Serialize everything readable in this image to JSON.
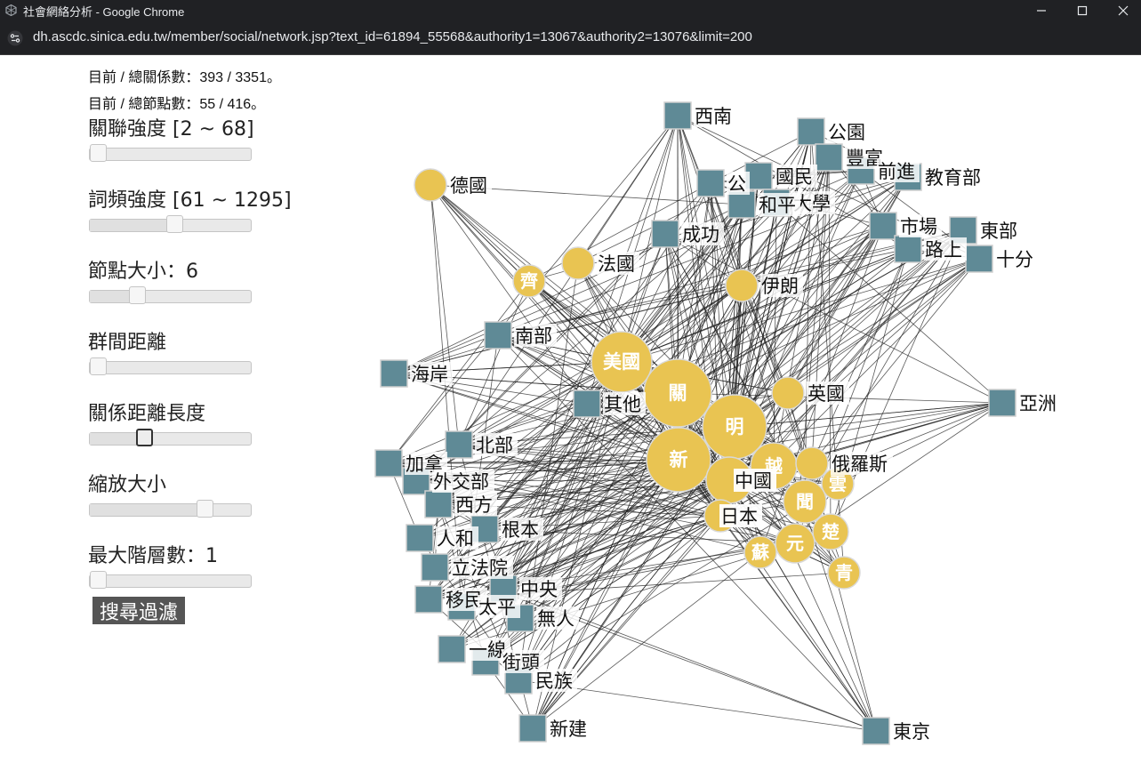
{
  "window": {
    "title": "社會網絡分析 - Google Chrome",
    "url": "dh.ascdc.sinica.edu.tw/member/social/network.jsp?text_id=61894_55568&authority1=13067&authority2=13076&limit=200"
  },
  "stats": {
    "relations": "目前 / 總關係數：393 / 3351。",
    "nodes": "目前 / 總節點數：55 / 416。"
  },
  "controls": {
    "relation_strength": {
      "label": "關聯強度 [2 ~ 68]",
      "value": 0.0
    },
    "word_frequency": {
      "label": "詞頻強度 [61 ~ 1295]",
      "value": 0.53
    },
    "node_size": {
      "label": "節點大小：6",
      "value": 0.27
    },
    "group_distance": {
      "label": "群間距離",
      "value": 0.0
    },
    "relation_distance": {
      "label": "關係距離長度",
      "value": 0.32
    },
    "zoom": {
      "label": "縮放大小",
      "value": 0.74
    },
    "max_levels": {
      "label": "最大階層數：1",
      "value": 0.0
    }
  },
  "search_button": "搜尋過濾",
  "colors": {
    "place_node": "#5f8a96",
    "person_node": "#e9c452",
    "edge": "#222222"
  },
  "graph": {
    "hubs": [
      "美國",
      "關",
      "明",
      "新",
      "中國",
      "日本"
    ],
    "square_nodes": [
      "西南",
      "公園",
      "豐富",
      "前進",
      "教育部",
      "國民",
      "公",
      "大學",
      "和平",
      "成功",
      "市場",
      "東部",
      "路上",
      "十分",
      "南部",
      "海岸",
      "其他",
      "亞洲",
      "北部",
      "加拿",
      "外交部",
      "西方",
      "根本",
      "人和",
      "立法院",
      "移民",
      "中央",
      "太平",
      "無人",
      "一線",
      "街頭",
      "民族",
      "新建",
      "東京"
    ],
    "circle_nodes": [
      "德國",
      "齊",
      "法國",
      "伊朗",
      "美國",
      "英國",
      "關",
      "明",
      "新",
      "越",
      "中國",
      "俄羅斯",
      "雲",
      "日本",
      "聞",
      "楚",
      "元",
      "蘇",
      "青"
    ]
  }
}
